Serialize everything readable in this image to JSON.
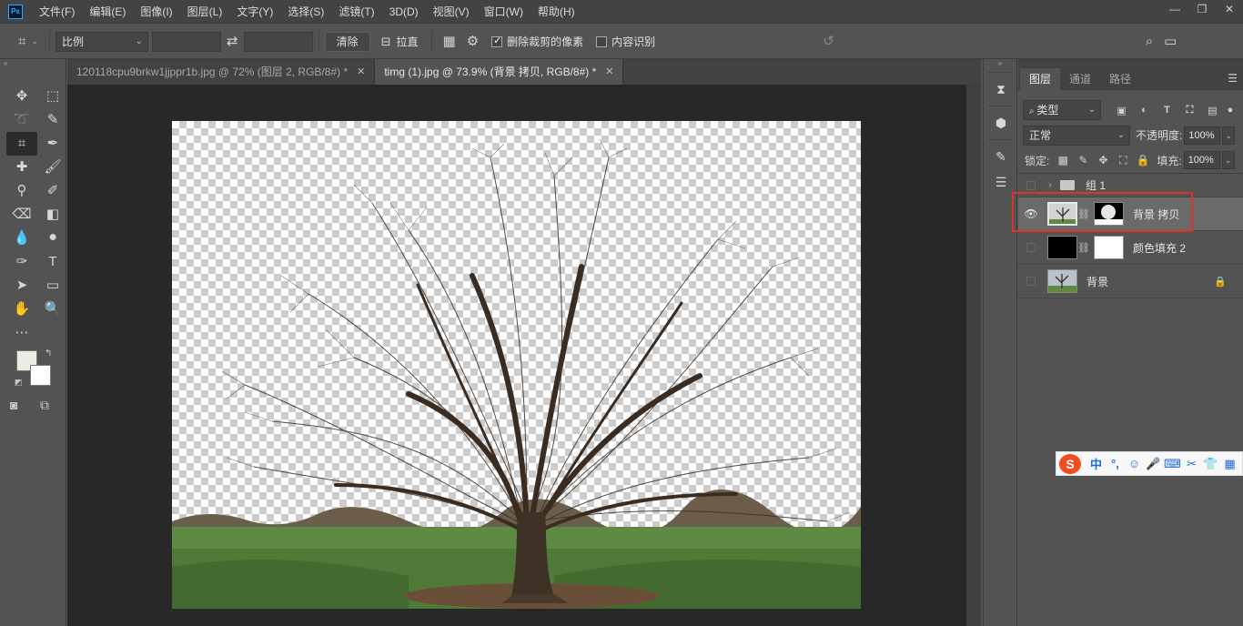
{
  "app": {
    "logo": "Ps"
  },
  "menu": [
    "文件(F)",
    "编辑(E)",
    "图像(I)",
    "图层(L)",
    "文字(Y)",
    "选择(S)",
    "滤镜(T)",
    "3D(D)",
    "视图(V)",
    "窗口(W)",
    "帮助(H)"
  ],
  "window_controls": {
    "minimize": "—",
    "restore": "❐",
    "close": "✕"
  },
  "options": {
    "ratio_select": "比例",
    "clear_button": "清除",
    "straighten_label": "拉直",
    "delete_cropped_label": "删除裁剪的像素",
    "delete_cropped_checked": true,
    "content_aware_label": "内容识别",
    "content_aware_checked": false
  },
  "tabs": [
    {
      "label": "120118cpu9brkw1jjppr1b.jpg @ 72% (图层 2, RGB/8#) *",
      "active": false
    },
    {
      "label": "timg (1).jpg @ 73.9% (背景 拷贝, RGB/8#) *",
      "active": true
    }
  ],
  "colors": {
    "foreground": "#ecebe3",
    "background": "#ffffff",
    "highlight": "#e0312b",
    "accent": "#31a8ff"
  },
  "layers_panel": {
    "tabs": [
      "图层",
      "通道",
      "路径"
    ],
    "active_tab": "图层",
    "kind_filter": "类型",
    "blend_mode": "正常",
    "opacity_label": "不透明度:",
    "opacity": "100%",
    "lock_label": "锁定:",
    "fill_label": "填充:",
    "fill": "100%",
    "layers": [
      {
        "name": "组 1",
        "type": "group",
        "visible": false,
        "selected": false
      },
      {
        "name": "背景 拷贝",
        "type": "image-with-mask",
        "visible": true,
        "selected": true
      },
      {
        "name": "颜色填充 2",
        "type": "fill",
        "visible": false,
        "selected": false
      },
      {
        "name": "背景",
        "type": "background",
        "visible": false,
        "selected": false,
        "locked": true
      }
    ]
  },
  "ime": {
    "logo": "S",
    "items": [
      "中",
      "°,",
      "☺",
      "🎤",
      "⌨",
      "✂",
      "👕",
      "▦"
    ]
  }
}
